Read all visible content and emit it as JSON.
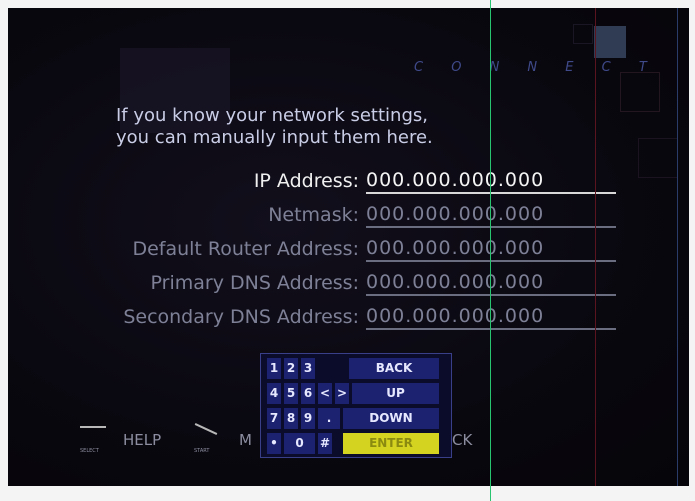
{
  "header": {
    "title": "C O N N E C T"
  },
  "intro": {
    "line1": "If you know your network settings,",
    "line2": "you can manually input them here."
  },
  "fields": [
    {
      "label": "IP Address:",
      "value": "000.000.000.000",
      "active": true
    },
    {
      "label": "Netmask:",
      "value": "000.000.000.000",
      "active": false
    },
    {
      "label": "Default Router Address:",
      "value": "000.000.000.000",
      "active": false
    },
    {
      "label": "Primary DNS Address:",
      "value": "000.000.000.000",
      "active": false
    },
    {
      "label": "Secondary DNS Address:",
      "value": "000.000.000.000",
      "active": false
    }
  ],
  "keypad": {
    "keys": {
      "k1": "1",
      "k2": "2",
      "k3": "3",
      "back": "BACK",
      "k4": "4",
      "k5": "5",
      "k6": "6",
      "left": "<",
      "right": ">",
      "up": "UP",
      "k7": "7",
      "k8": "8",
      "k9": "9",
      "dot": ".",
      "down": "DOWN",
      "bullet": "•",
      "k0": "0",
      "hash": "#",
      "enter": "ENTER"
    }
  },
  "footer": {
    "select_label": "SELECT",
    "help_label": "HELP",
    "start_label": "START",
    "menu_label": "M",
    "back_label": "CK"
  },
  "colors": {
    "keypad_bg": "#1d2270",
    "enter_key": "#d4d320",
    "active_text": "#f4f4f4",
    "inactive_text": "#7d8096"
  }
}
